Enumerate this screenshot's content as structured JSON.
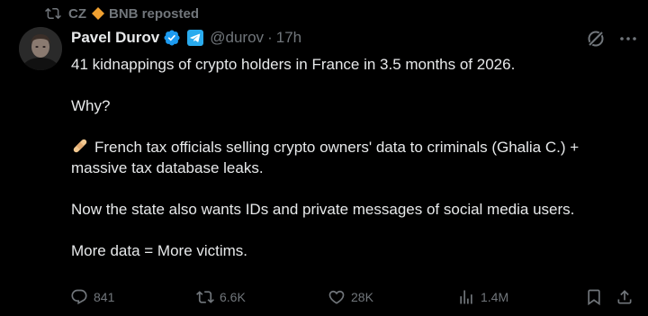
{
  "repost": {
    "reposter_name": "CZ",
    "reposter_suffix": "BNB reposted"
  },
  "author": {
    "display_name": "Pavel Durov",
    "handle": "@durov",
    "separator": "·",
    "timestamp": "17h"
  },
  "tweet": {
    "line1": "41 kidnappings of crypto holders in France in 3.5 months of 2026.",
    "line2": "Why?",
    "line3": "French tax officials selling crypto owners' data to criminals (Ghalia C.) +",
    "line4": "massive tax database leaks.",
    "line5": "Now the state also wants IDs and private messages of social media users.",
    "line6": "More data = More victims."
  },
  "actions": {
    "replies": "841",
    "reposts": "6.6K",
    "likes": "28K",
    "views": "1.4M"
  },
  "colors": {
    "background": "#000000",
    "text": "#e7e9ea",
    "muted": "#71767b",
    "verified": "#1d9bf0",
    "binance_diamond": "#f0a030",
    "bandage": "#f2c890"
  },
  "icons": {
    "repost_line": "repost-icon",
    "reposter_badge": "diamond-icon",
    "verified": "verified-badge-icon",
    "affiliate": "telegram-icon",
    "grok": "grok-icon",
    "more": "more-icon",
    "emoji": "adhesive-bandage-icon",
    "reply": "reply-icon",
    "repost": "repost-icon",
    "like": "heart-icon",
    "views": "views-chart-icon",
    "bookmark": "bookmark-icon",
    "share": "share-icon"
  }
}
